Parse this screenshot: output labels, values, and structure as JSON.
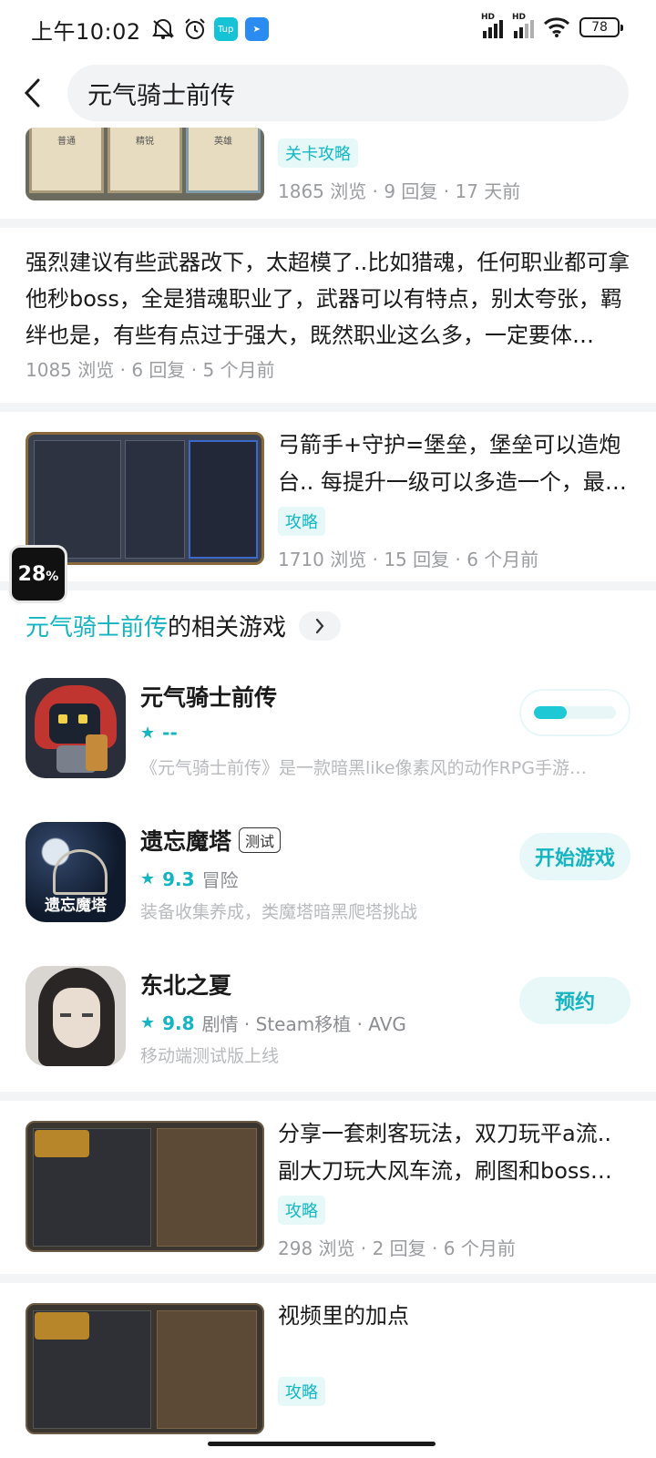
{
  "status_bar": {
    "time": "上午10:02",
    "battery": "78",
    "signal_label": "HD"
  },
  "header": {
    "search_value": "元气骑士前传"
  },
  "posts": [
    {
      "tag": "关卡攻略",
      "meta": "1865 浏览 · 9 回复 · 17 天前",
      "thumb_labels": [
        "普通",
        "精锐",
        "英雄"
      ]
    },
    {
      "title": "强烈建议有些武器改下，太超模了..比如猎魂，任何职业都可拿他秒boss，全是猎魂职业了，武器可以有特点，别太夸张，羁绊也是，有些有点过于强大，既然职业这么多，一定要体…",
      "meta": "1085 浏览 · 6 回复 · 5 个月前"
    },
    {
      "title": "弓箭手+守护=堡垒，堡垒可以造炮台.. 每提升一级可以多造一个，最…",
      "tag": "攻略",
      "meta": "1710 浏览 · 15 回复 · 6 个月前"
    },
    {
      "title": "分享一套刺客玩法，双刀玩平a流.. 副大刀玩大风车流，刷图和boss…",
      "tag": "攻略",
      "meta": "298 浏览 · 2 回复 · 6 个月前"
    },
    {
      "title": "视频里的加点",
      "tag": "攻略"
    }
  ],
  "related": {
    "title_highlight": "元气骑士前传",
    "title_rest": "的相关游戏",
    "games": [
      {
        "name": "元气骑士前传",
        "rating": "--",
        "desc": "《元气骑士前传》是一款暗黑like像素风的动作RPG手游…",
        "progress": 0.4
      },
      {
        "name": "遗忘魔塔",
        "badge": "测试",
        "rating": "9.3",
        "genre": "冒险",
        "desc": "装备收集养成，类魔塔暗黑爬塔挑战",
        "button": "开始游戏",
        "icon_text": "遗忘魔塔"
      },
      {
        "name": "东北之夏",
        "rating": "9.8",
        "genre": "剧情 · Steam移植 · AVG",
        "desc": "移动端测试版上线",
        "button": "预约"
      }
    ]
  },
  "float_badge": {
    "value": "28",
    "unit": "%"
  },
  "colors": {
    "accent": "#14b4c2",
    "tag_bg": "#e6f8f8",
    "divider": "#f3f4f6"
  }
}
